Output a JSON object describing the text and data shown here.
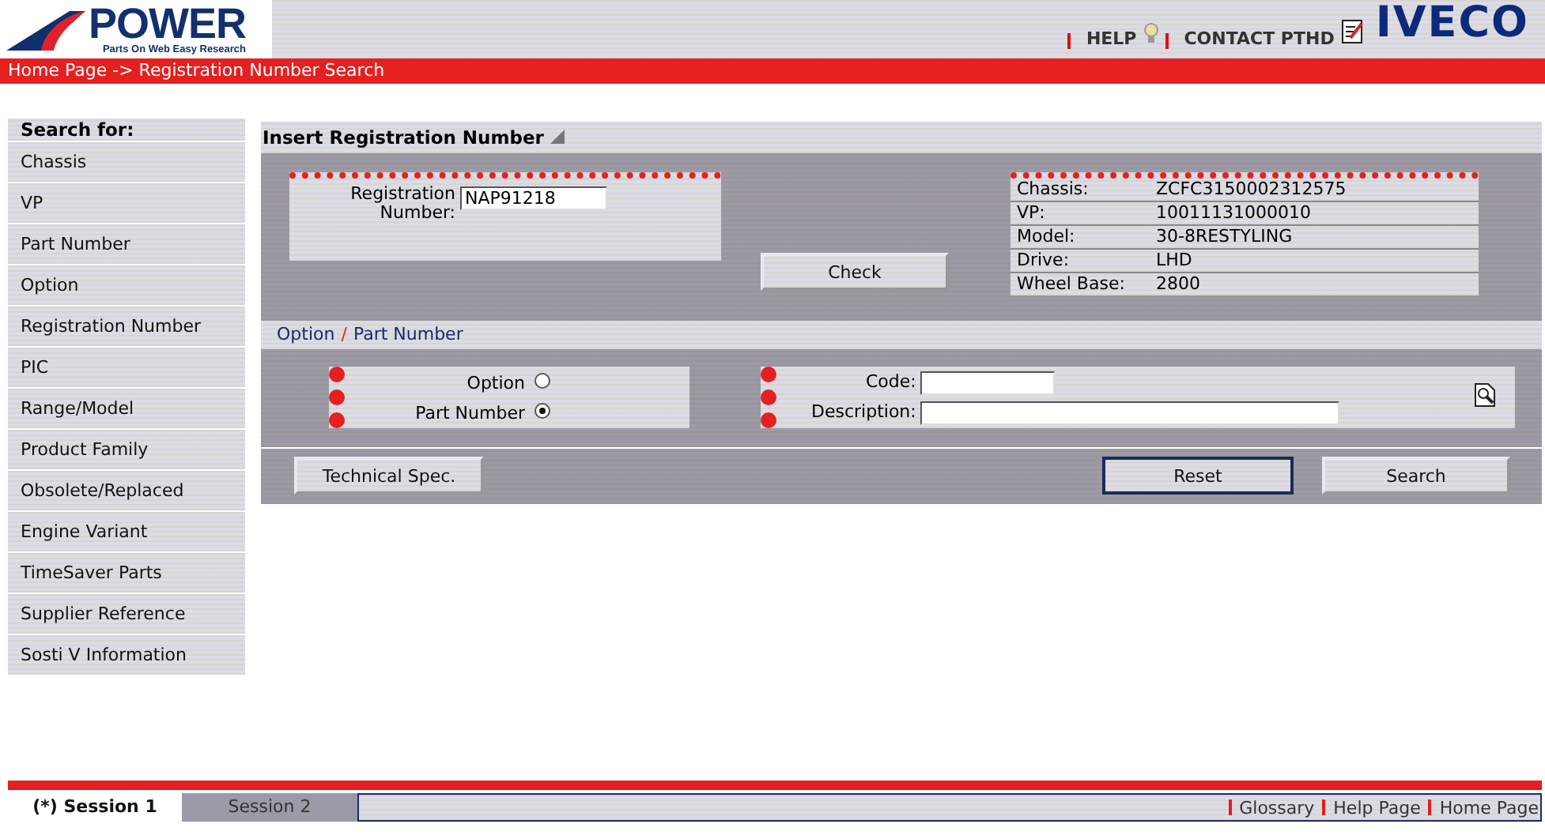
{
  "header": {
    "logo_title": "POWER",
    "logo_subtitle": "Parts On Web Easy Research",
    "links": [
      "HELP",
      "CONTACT PTHD"
    ],
    "brand": "IVECO"
  },
  "breadcrumb": "Home Page -> Registration Number Search",
  "sidebar": {
    "title": "Search for:",
    "items": [
      "Chassis",
      "VP",
      "Part Number",
      "Option",
      "Registration Number",
      "PIC",
      "Range/Model",
      "Product Family",
      "Obsolete/Replaced",
      "Engine Variant",
      "TimeSaver Parts",
      "Supplier Reference",
      "Sosti V Information"
    ]
  },
  "main": {
    "title": "Insert Registration Number",
    "registration": {
      "label": "Registration Number:",
      "value": "NAP91218"
    },
    "check_button": "Check",
    "vehicle_info": [
      {
        "label": "Chassis:",
        "value": "ZCFC3150002312575"
      },
      {
        "label": "VP:",
        "value": "10011131000010"
      },
      {
        "label": "Model:",
        "value": "30-8RESTYLING"
      },
      {
        "label": "Drive:",
        "value": "LHD"
      },
      {
        "label": "Wheel Base:",
        "value": "2800"
      }
    ],
    "section_title": {
      "first": "Option",
      "separator": "/",
      "second": "Part Number"
    },
    "search_by": [
      {
        "label": "Option",
        "selected": false
      },
      {
        "label": "Part Number",
        "selected": true
      }
    ],
    "code": {
      "label": "Code:"
    },
    "description": {
      "label": "Description:"
    },
    "buttons": {
      "technical_spec": "Technical Spec.",
      "reset": "Reset",
      "search": "Search"
    }
  },
  "footer": {
    "tabs": [
      {
        "label": "(*) Session 1",
        "selected": true
      },
      {
        "label": "Session 2",
        "selected": false
      }
    ],
    "links": [
      "Glossary",
      "Help Page",
      "Home Page"
    ]
  }
}
